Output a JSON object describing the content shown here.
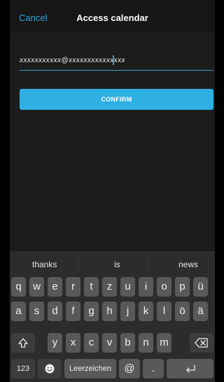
{
  "nav": {
    "cancel_label": "Cancel",
    "title": "Access calendar"
  },
  "form": {
    "email_value": "xxxxxxxxxxx@xxxxxxxxxxxxxxx",
    "confirm_label": "CONFIRM"
  },
  "keyboard": {
    "suggestions": [
      "thanks",
      "is",
      "news"
    ],
    "row1": [
      "q",
      "w",
      "e",
      "r",
      "t",
      "z",
      "u",
      "i",
      "o",
      "p",
      "ü"
    ],
    "row2": [
      "a",
      "s",
      "d",
      "f",
      "g",
      "h",
      "j",
      "k",
      "l",
      "ö",
      "ä"
    ],
    "row3": [
      "y",
      "x",
      "c",
      "v",
      "b",
      "n",
      "m"
    ],
    "numbers_label": "123",
    "space_label": "Leerzeichen",
    "at_label": "@",
    "dot_label": ".",
    "icons": {
      "shift": "shift-icon",
      "backspace": "backspace-icon",
      "emoji": "emoji-icon",
      "return": "return-icon"
    }
  }
}
